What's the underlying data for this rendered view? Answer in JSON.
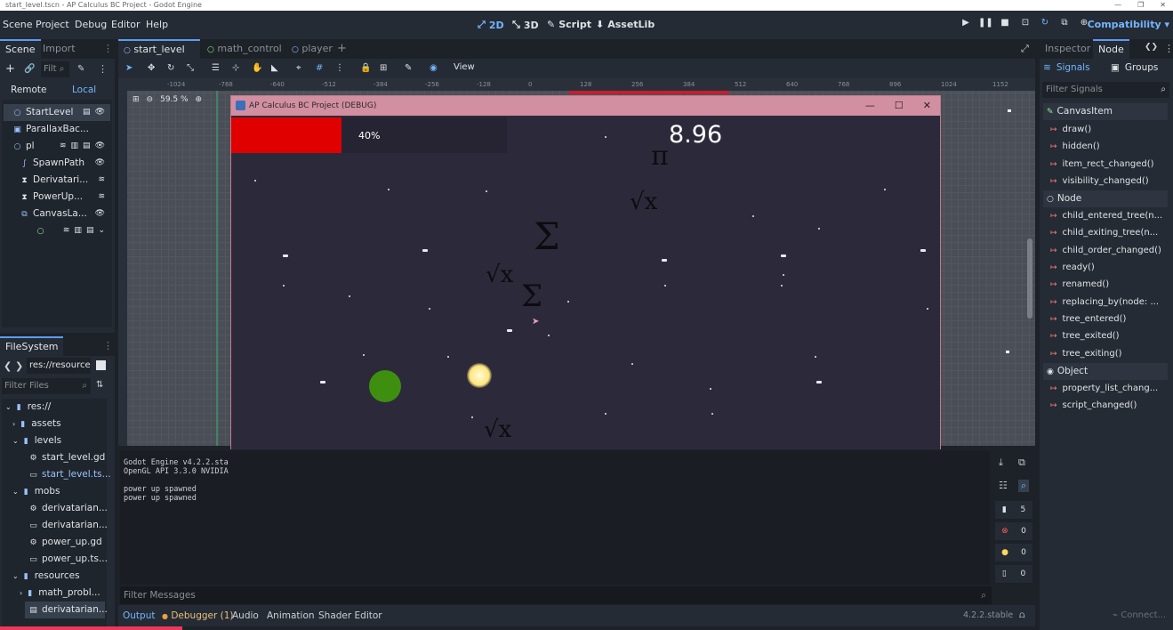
{
  "window": {
    "title": "start_level.tscn - AP Calculus BC Project - Godot Engine"
  },
  "menu": {
    "items": [
      "Scene",
      "Project",
      "Debug",
      "Editor",
      "Help"
    ],
    "workspaces": [
      "2D",
      "3D",
      "Script",
      "AssetLib"
    ],
    "renderer": "Compatibility"
  },
  "scene_dock": {
    "tabs": [
      "Scene",
      "Import"
    ],
    "filter_placeholder": "Filt",
    "remote_label": "Remote",
    "local_label": "Local",
    "nodes": [
      "StartLevel",
      "ParallaxBac...",
      "pl",
      "SpawnPath",
      "Derivatari...",
      "PowerUp...",
      "CanvasLa..."
    ]
  },
  "filesystem": {
    "tab": "FileSystem",
    "path": "res://resource",
    "filter_placeholder": "Filter Files",
    "items": [
      "res://",
      "assets",
      "levels",
      "start_level.gd",
      "start_level.ts...",
      "mobs",
      "derivatarian...",
      "derivatarian...",
      "power_up.gd",
      "power_up.ts...",
      "resources",
      "math_probl...",
      "derivatarian..."
    ]
  },
  "editor_tabs": [
    "start_level",
    "math_control",
    "player"
  ],
  "viewport": {
    "zoom": "59.5 %",
    "view_label": "View",
    "ruler_ticks": [
      "-1024",
      "-768",
      "-640",
      "-512",
      "-384",
      "-256",
      "-128",
      "0",
      "128",
      "256",
      "384",
      "512",
      "640",
      "768",
      "896",
      "1024",
      "1152"
    ]
  },
  "game_window": {
    "title": "AP Calculus BC Project (DEBUG)",
    "health_percent": "40%",
    "health_fill_fraction": 0.4,
    "score": "8.96",
    "symbols": [
      "π",
      "√x",
      "Σ",
      "√x",
      "Σ",
      "√x"
    ],
    "colors": {
      "health_bar": "#e00000",
      "player": "#3e8f10",
      "orb": "#fff0a0"
    }
  },
  "console": {
    "lines": [
      "Godot Engine v4.2.2.sta",
      "OpenGL API 3.3.0 NVIDIA",
      "",
      "power up spawned",
      "power up spawned"
    ],
    "filter_placeholder": "Filter Messages",
    "counts": [
      "5",
      "0",
      "0",
      "0"
    ]
  },
  "bottom_tabs": [
    "Output",
    "Debugger (1)",
    "Audio",
    "Animation",
    "Shader Editor"
  ],
  "version": "4.2.2.stable",
  "right_dock": {
    "tabs": [
      "Inspector",
      "Node"
    ],
    "subtabs": [
      "Signals",
      "Groups"
    ],
    "filter_placeholder": "Filter Signals",
    "sections": [
      {
        "name": "CanvasItem",
        "signals": [
          "draw()",
          "hidden()",
          "item_rect_changed()",
          "visibility_changed()"
        ]
      },
      {
        "name": "Node",
        "signals": [
          "child_entered_tree(n...",
          "child_exiting_tree(n...",
          "child_order_changed()",
          "ready()",
          "renamed()",
          "replacing_by(node: ...",
          "tree_entered()",
          "tree_exited()",
          "tree_exiting()"
        ]
      },
      {
        "name": "Object",
        "signals": [
          "property_list_chang...",
          "script_changed()"
        ]
      }
    ],
    "connect_label": "Connect..."
  }
}
